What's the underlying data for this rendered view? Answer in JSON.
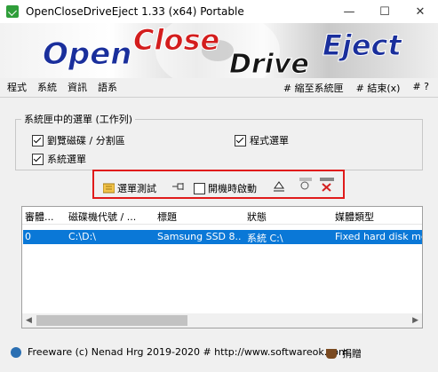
{
  "window": {
    "title": "OpenCloseDriveEject 1.33  (x64) Portable",
    "minimize": "—",
    "maximize": "☐",
    "close": "✕"
  },
  "banner": {
    "word1": "Open",
    "word2": "Close",
    "word3": "Drive",
    "word4": "Eject"
  },
  "menu": {
    "left": [
      "程式",
      "系統",
      "資訊",
      "語系"
    ],
    "right": [
      "# 縮至系統匣",
      "# 結束(x)",
      "# ?"
    ]
  },
  "group": {
    "label": "系統匣中的選單 (工作列)",
    "items": [
      "劉覽磁碟 / 分割區",
      "程式選單",
      "系統選單"
    ]
  },
  "toolbar": {
    "test_menu": "選單測試",
    "startup": "開機時啟動"
  },
  "list": {
    "columns": [
      "審體...",
      "磁碟機代號 / ...",
      "標題",
      "狀態",
      "媒體類型"
    ],
    "rows": [
      [
        "0",
        "C:\\D:\\",
        "Samsung SSD 8...",
        "系統 C:\\",
        "Fixed hard disk medi"
      ]
    ]
  },
  "footer": {
    "text": "Freeware (c) Nenad Hrg 2019-2020 # http://www.softwareok.com",
    "donate": "捐贈"
  }
}
